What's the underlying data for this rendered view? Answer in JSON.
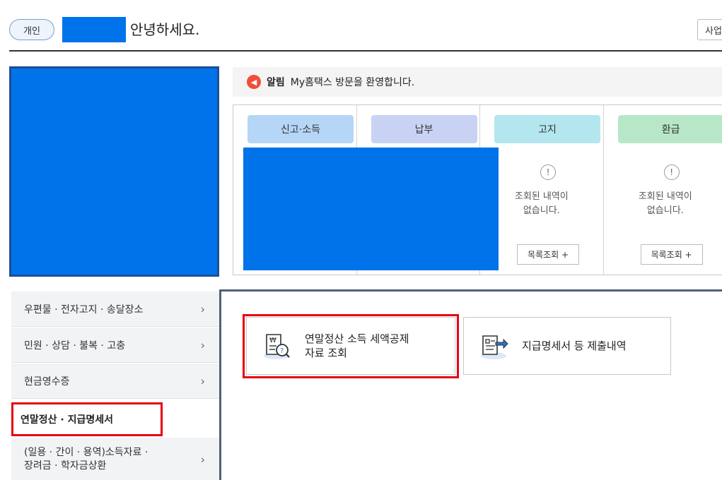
{
  "header": {
    "user_type": "개인",
    "greeting": "안녕하세요.",
    "biz_button": "사업"
  },
  "notice": {
    "label": "알림",
    "message": "My홈택스 방문을 환영합니다."
  },
  "status": [
    {
      "title": "신고·소득",
      "color": "#b5d6f6"
    },
    {
      "title": "납부",
      "color": "#c8d3f4"
    },
    {
      "title": "고지",
      "color": "#b4e6f0",
      "empty_message": "조회된 내역이\n없습니다.",
      "button": "목록조회 +"
    },
    {
      "title": "환급",
      "color": "#b7e7c7",
      "empty_message": "조회된 내역이\n없습니다.",
      "button": "목록조회 +"
    }
  ],
  "sidebar": {
    "items": [
      {
        "label": "우편물 · 전자고지 · 송달장소"
      },
      {
        "label": "민원 · 상담 · 불복 · 고충"
      },
      {
        "label": "현금영수증"
      },
      {
        "label": "연말정산 · 지급명세서"
      },
      {
        "label": "(일용 · 간이 · 용역)소득자료 ·\n장려금 · 학자금상환"
      }
    ]
  },
  "cards": [
    {
      "label": "연말정산 소득 세액공제\n자료 조회",
      "icon": "tax-receipt-search-icon"
    },
    {
      "label": "지급명세서 등 제출내역",
      "icon": "document-export-icon"
    }
  ]
}
